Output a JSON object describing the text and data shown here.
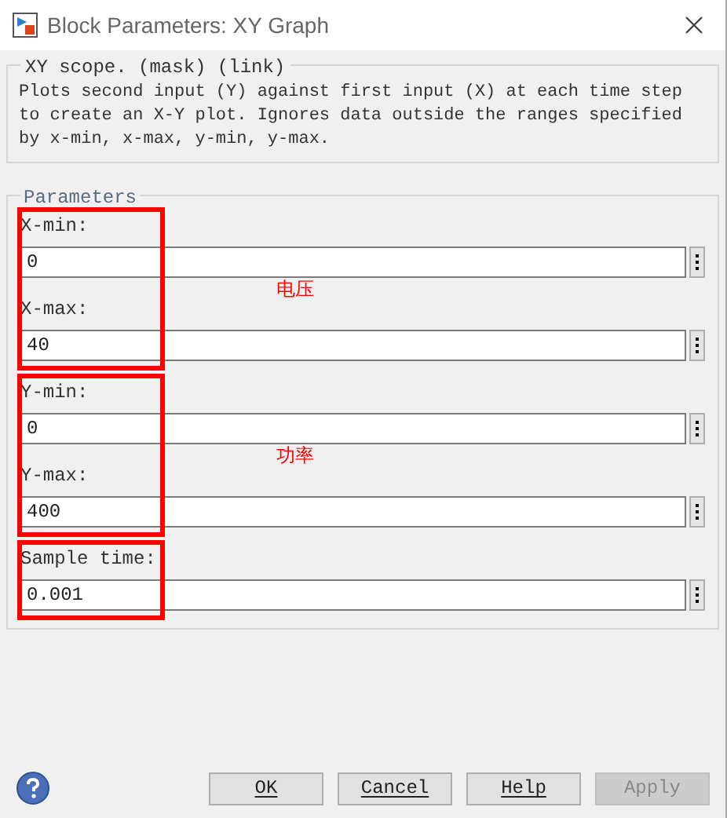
{
  "window": {
    "title": "Block Parameters: XY Graph"
  },
  "description": {
    "title": "XY scope. (mask) (link)",
    "text": "Plots second input (Y) against first input (X) at each time step to create an X-Y plot. Ignores data outside the ranges specified by x-min, x-max, y-min, y-max."
  },
  "parameters": {
    "title": "Parameters",
    "groups": [
      {
        "annotation": "电压",
        "fields": [
          {
            "label": "X-min:",
            "value": "0"
          },
          {
            "label": "X-max:",
            "value": "40"
          }
        ]
      },
      {
        "annotation": "功率",
        "fields": [
          {
            "label": "Y-min:",
            "value": "0"
          },
          {
            "label": "Y-max:",
            "value": "400"
          }
        ]
      },
      {
        "fields": [
          {
            "label": "Sample time:",
            "value": "0.001"
          }
        ]
      }
    ]
  },
  "buttons": [
    {
      "label": "OK",
      "disabled": false
    },
    {
      "label": "Cancel",
      "disabled": false
    },
    {
      "label": "Help",
      "disabled": false
    },
    {
      "label": "Apply",
      "disabled": true
    }
  ]
}
